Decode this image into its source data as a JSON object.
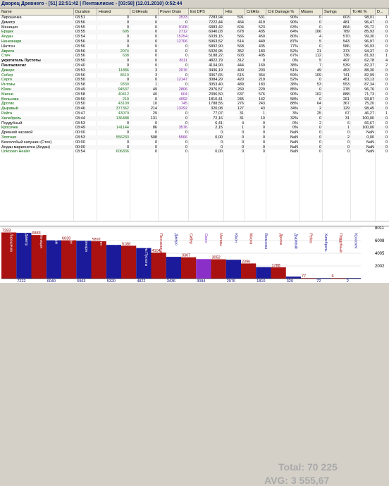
{
  "window": {
    "title": "Дворец Древнего - [51] 22:51:42 | Пентаклисис - [03:58] (12.01.2010) 0:52:44"
  },
  "table": {
    "columns": [
      "Name",
      "Duration",
      "Healed",
      "CritHeals",
      "Power Drain",
      "Ext DPS",
      "Hits",
      "CritHits",
      "Crit Damage %",
      "Misses",
      "Swings",
      "To Hit %",
      "D..."
    ],
    "rows": [
      {
        "name": "Лирошечка",
        "duration": "03:51",
        "healed": "0",
        "critheals": "0",
        "powerdrain": "2533",
        "extdps": "7283,94",
        "hits": "591",
        "crithits": "531",
        "critdmg": "90%",
        "misses": "0",
        "swings": "603",
        "tohit": "98,01",
        "d": "1"
      },
      {
        "name": "Диметр",
        "duration": "03:56",
        "healed": "0",
        "critheals": "0",
        "powerdrain": "0",
        "extdps": "7222,44",
        "hits": "464",
        "crithits": "419",
        "critdmg": "90%",
        "misses": "0",
        "swings": "481",
        "tohit": "96,47",
        "d": "0"
      },
      {
        "name": "Мениция",
        "duration": "03:55",
        "healed": "0",
        "critheals": "0",
        "powerdrain": "9108",
        "extdps": "6883,42",
        "hits": "604",
        "crithits": "523",
        "critdmg": "63%",
        "misses": "0",
        "swings": "864",
        "tohit": "95,72",
        "d": "0"
      },
      {
        "name": "Ерщик",
        "duration": "03:55",
        "healed": "695",
        "critheals": "0",
        "powerdrain": "2712",
        "extdps": "6040,03",
        "crithits": "435",
        "hits": "678",
        "critdmg": "64%",
        "misses": "106",
        "swings": "789",
        "tohit": "85,93",
        "d": "0"
      },
      {
        "name": "Алдан",
        "duration": "03:54",
        "healed": "0",
        "critheals": "0",
        "powerdrain": "15254",
        "extdps": "6039,15",
        "hits": "566",
        "crithits": "450",
        "critdmg": "80%",
        "misses": "4",
        "swings": "570",
        "tohit": "99,30",
        "d": "0"
      },
      {
        "name": "Ненеянари",
        "duration": "03:56",
        "healed": "0",
        "critheals": "0",
        "powerdrain": "12706",
        "extdps": "5963,52",
        "hits": "514",
        "crithits": "449",
        "critdmg": "87%",
        "misses": "5",
        "swings": "543",
        "tohit": "96,97",
        "d": "0"
      },
      {
        "name": "Шаттен",
        "duration": "03:56",
        "healed": "0",
        "critheals": "0",
        "powerdrain": "0",
        "extdps": "5892,90",
        "hits": "568",
        "crithits": "435",
        "critdmg": "77%",
        "misses": "0",
        "swings": "586",
        "tohit": "96,93",
        "d": "0"
      },
      {
        "name": "Аврита",
        "duration": "03:56",
        "healed": "2074",
        "critheals": "0",
        "powerdrain": "0",
        "extdps": "5320,95",
        "hits": "352",
        "crithits": "183",
        "critdmg": "52%",
        "misses": "21",
        "swings": "373",
        "tohit": "94,37",
        "d": "0"
      },
      {
        "name": "Стич",
        "duration": "03:56",
        "healed": "638",
        "critheals": "0",
        "powerdrain": "0",
        "extdps": "5188,22",
        "hits": "603",
        "crithits": "405",
        "critdmg": "67%",
        "misses": "112",
        "swings": "736",
        "tohit": "81,93",
        "d": "1"
      },
      {
        "name": "укротитель Пустоты",
        "duration": "03:50",
        "healed": "0",
        "critheals": "0",
        "powerdrain": "8111",
        "extdps": "4822,79",
        "hits": "312",
        "crithits": "0",
        "critdmg": "0%",
        "misses": "5",
        "swings": "497",
        "tohit": "62,78",
        "d": "4"
      },
      {
        "name": "Пентаклисис",
        "duration": "03:40",
        "healed": "0",
        "critheals": "0",
        "powerdrain": "0",
        "extdps": "4104,90",
        "hits": "444",
        "crithits": "169",
        "critdmg": "38%",
        "misses": "7",
        "swings": "539",
        "tohit": "82,37",
        "d": "2"
      },
      {
        "name": "Дикеро",
        "duration": "03:53",
        "healed": "11886",
        "critheals": "3",
        "powerdrain": "2076",
        "extdps": "3436,19",
        "hits": "400",
        "crithits": "203",
        "critdmg": "51%",
        "misses": "49",
        "swings": "453",
        "tohit": "88,30",
        "d": "0"
      },
      {
        "name": "Сибер",
        "duration": "03:56",
        "healed": "8610",
        "critheals": "3",
        "powerdrain": "0",
        "extdps": "3367,65",
        "hits": "615",
        "crithits": "364",
        "critdmg": "59%",
        "misses": "109",
        "swings": "741",
        "tohit": "82,99",
        "d": "0"
      },
      {
        "name": "Серго",
        "duration": "03:50",
        "healed": "0",
        "critheals": "0",
        "powerdrain": "12147",
        "extdps": "3084,29",
        "hits": "420",
        "crithits": "219",
        "critdmg": "52%",
        "misses": "0",
        "swings": "451",
        "tohit": "93,13",
        "d": "0"
      },
      {
        "name": "Интовы",
        "duration": "03:58",
        "healed": "9330",
        "critheals": "1",
        "powerdrain": "0",
        "extdps": "3053,40",
        "hits": "489",
        "crithits": "183",
        "critdmg": "38%",
        "misses": "53",
        "swings": "553",
        "tohit": "87,34",
        "d": "0"
      },
      {
        "name": "Юкон",
        "duration": "03:49",
        "healed": "94537",
        "critheals": "49",
        "powerdrain": "2806",
        "extdps": "2976,57",
        "hits": "269",
        "crithits": "229",
        "critdmg": "85%",
        "misses": "0",
        "swings": "278",
        "tohit": "96,76",
        "d": "0"
      },
      {
        "name": "Миони",
        "duration": "03:58",
        "healed": "40412",
        "critheals": "40",
        "powerdrain": "604",
        "extdps": "2396,50",
        "hits": "637",
        "crithits": "576",
        "critdmg": "90%",
        "misses": "102",
        "swings": "888",
        "tohit": "71,73",
        "d": "0"
      },
      {
        "name": "Вольника",
        "duration": "03:50",
        "healed": "219",
        "critheals": "0",
        "powerdrain": "4092",
        "extdps": "1810,41",
        "hits": "245",
        "crithits": "142",
        "critdmg": "58%",
        "misses": "0",
        "swings": "261",
        "tohit": "93,87",
        "d": "0"
      },
      {
        "name": "Дротик",
        "duration": "03:50",
        "healed": "43109",
        "critheals": "10",
        "powerdrain": "745",
        "extdps": "1788,55",
        "hits": "276",
        "crithits": "243",
        "critdmg": "88%",
        "misses": "64",
        "swings": "367",
        "tohit": "75,20",
        "d": "0"
      },
      {
        "name": "Дыравый",
        "duration": "03:46",
        "healed": "377362",
        "critheals": "214",
        "powerdrain": "13292",
        "extdps": "320,08",
        "hits": "127",
        "crithits": "43",
        "critdmg": "34%",
        "misses": "2",
        "swings": "129",
        "tohit": "98,45",
        "d": "0"
      },
      {
        "name": "Рейта",
        "duration": "03:47",
        "healed": "43079",
        "critheals": "29",
        "powerdrain": "0",
        "extdps": "77,07",
        "hits": "31",
        "crithits": "1",
        "critdmg": "3%",
        "misses": "25",
        "swings": "67",
        "tohit": "46,27",
        "d": "1"
      },
      {
        "name": "Хилебрель",
        "duration": "03:44",
        "healed": "136488",
        "critheals": "131",
        "powerdrain": "0",
        "extdps": "72,16",
        "hits": "31",
        "crithits": "10",
        "critdmg": "32%",
        "misses": "0",
        "swings": "31",
        "tohit": "100,00",
        "d": "0"
      },
      {
        "name": "Поддубный",
        "duration": "03:53",
        "healed": "0",
        "critheals": "0",
        "powerdrain": "0",
        "extdps": "6,41",
        "hits": "4",
        "crithits": "0",
        "critdmg": "0%",
        "misses": "2",
        "swings": "6",
        "tohit": "66,67",
        "d": "0"
      },
      {
        "name": "Кросочек",
        "duration": "03:49",
        "healed": "141144",
        "critheals": "86",
        "powerdrain": "3576",
        "extdps": "2,15",
        "hits": "1",
        "crithits": "0",
        "critdmg": "0%",
        "misses": "0",
        "swings": "1",
        "tohit": "100,00",
        "d": "0"
      },
      {
        "name": "Древний часовой",
        "duration": "00:00",
        "healed": "0",
        "critheals": "0",
        "powerdrain": "0",
        "extdps": "0",
        "hits": "0",
        "crithits": "0",
        "critdmg": "NaN",
        "misses": "0",
        "swings": "0",
        "tohit": "NaN",
        "d": "0"
      },
      {
        "name": "Злотная",
        "duration": "03:53",
        "healed": "556233",
        "critheals": "508",
        "powerdrain": "5566",
        "extdps": "0,00",
        "hits": "0",
        "crithits": "0",
        "critdmg": "NaN",
        "misses": "0",
        "swings": "2",
        "tohit": "0,00",
        "d": "0"
      },
      {
        "name": "Безголобый капушин (Стич)",
        "duration": "00:00",
        "healed": "0",
        "critheals": "0",
        "powerdrain": "0",
        "extdps": "0",
        "hits": "0",
        "crithits": "0",
        "critdmg": "NaN",
        "misses": "0",
        "swings": "0",
        "tohit": "NaN",
        "d": "0"
      },
      {
        "name": "Алдан марионетка (Алдан)",
        "duration": "00:00",
        "healed": "0",
        "critheals": "0",
        "powerdrain": "0",
        "extdps": "0",
        "hits": "0",
        "crithits": "0",
        "critdmg": "NaN",
        "misses": "0",
        "swings": "0",
        "tohit": "NaN",
        "d": "0"
      },
      {
        "name": "Unknown Healer",
        "duration": "03:54",
        "healed": "606836",
        "critheals": "0",
        "powerdrain": "0",
        "extdps": "0,00",
        "hits": "0",
        "crithits": "0",
        "critdmg": "NaN",
        "misses": "0",
        "swings": "0",
        "tohit": "NaN",
        "d": "0"
      }
    ]
  },
  "chart": {
    "total_label": "Total: 70 225",
    "avg_label": "AVG: 3 555,67",
    "y_ticks": [
      "8011",
      "6008",
      "4005",
      "2002"
    ],
    "bars": [
      {
        "name": "Лирошечка",
        "value": 7283,
        "color": "#aa1111"
      },
      {
        "name": "Диметр",
        "value": 7222,
        "color": "#1a1a9a"
      },
      {
        "name": "Мениция",
        "value": 6883,
        "color": "#aa1111"
      },
      {
        "name": "Ерщик",
        "value": 6040,
        "color": "#1a1a9a"
      },
      {
        "name": "Алдан",
        "value": 6039,
        "color": "#aa1111"
      },
      {
        "name": "Ненеянари",
        "value": 5963,
        "color": "#1a1a9a"
      },
      {
        "name": "Шаттен",
        "value": 5892,
        "color": "#aa1111"
      },
      {
        "name": "Аврита",
        "value": 5320,
        "color": "#1a1a9a"
      },
      {
        "name": "Стич",
        "value": 5188,
        "color": "#aa1111"
      },
      {
        "name": "укротитель Пустоты",
        "value": 4822,
        "color": "#1a1a9a"
      },
      {
        "name": "Пентаклисис",
        "value": 4104,
        "color": "#aa1111"
      },
      {
        "name": "Дикеро",
        "value": 3436,
        "color": "#1a1a9a"
      },
      {
        "name": "Сибер",
        "value": 3367,
        "color": "#aa1111"
      },
      {
        "name": "Серго",
        "value": 3084,
        "color": "#8b2fc9"
      },
      {
        "name": "Интовы",
        "value": 3052,
        "color": "#aa1111"
      },
      {
        "name": "Юкон",
        "value": 2976,
        "color": "#1a1a9a"
      },
      {
        "name": "Миони",
        "value": 2396,
        "color": "#aa1111"
      },
      {
        "name": "Вольника",
        "value": 1810,
        "color": "#1a1a9a"
      },
      {
        "name": "Дротик",
        "value": 1788,
        "color": "#aa1111"
      },
      {
        "name": "Дыравый",
        "value": 320,
        "color": "#1a1a9a"
      },
      {
        "name": "Рейта",
        "value": 77,
        "color": "#aa1111"
      },
      {
        "name": "Хилебрель",
        "value": 72,
        "color": "#1a1a9a"
      },
      {
        "name": "Поддубный",
        "value": 6,
        "color": "#aa1111"
      },
      {
        "name": "Кросочек",
        "value": 2,
        "color": "#1a1a9a"
      }
    ],
    "ymax": 8011
  }
}
